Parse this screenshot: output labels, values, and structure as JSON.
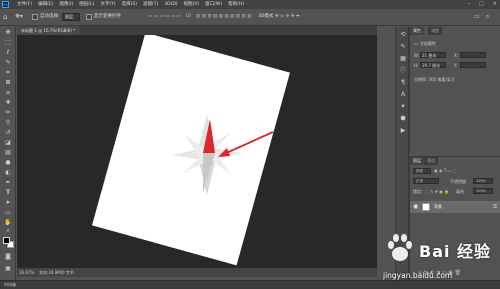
{
  "app": {
    "logo_text": "Ps"
  },
  "menubar": {
    "items": [
      "文件(F)",
      "编辑(E)",
      "图像(I)",
      "图层(L)",
      "文字(Y)",
      "选择(S)",
      "滤镜(T)",
      "3D(D)",
      "视图(V)",
      "窗口(W)",
      "帮助(H)"
    ],
    "window_controls": [
      "–",
      "□",
      "×"
    ]
  },
  "options": {
    "home_icon": "home-icon",
    "tool_icon": "move-tool-icon",
    "auto_select_label": "自动选择:",
    "auto_select_value": "图层",
    "show_transform_label": "显示变换控件",
    "align_label": "ID",
    "mode_3d_label": "3D模式"
  },
  "document": {
    "tab_title": "未标题-1 @ 16.7%(RGB/8) *",
    "zoom": "16.67%",
    "info": "文档:24.9M/0 字节"
  },
  "timeline": {
    "label": "时间轴"
  },
  "properties": {
    "tabs": [
      "属性",
      "调整"
    ],
    "section": "文档属性",
    "w_label": "W:",
    "w_value": "21 厘米",
    "h_label": "H:",
    "h_value": "29.7 厘米",
    "x_label": "X:",
    "y_label": "Y:",
    "resolution": "分辨率: 300 像素/英寸"
  },
  "layers": {
    "tabs": [
      "图层",
      "通道"
    ],
    "kind_label": "类型",
    "blend_mode": "正常",
    "opacity_label": "不透明度:",
    "opacity_value": "100%",
    "lock_label": "锁定:",
    "fill_label": "填充:",
    "fill_value": "100%",
    "layer_name": "背景"
  },
  "colors": {
    "accent_red": "#d9262b",
    "canvas_bg": "#282828",
    "panel_bg": "#535353"
  },
  "watermark": {
    "text": "Bai  经验",
    "url": "jingyan.baidu.com"
  }
}
